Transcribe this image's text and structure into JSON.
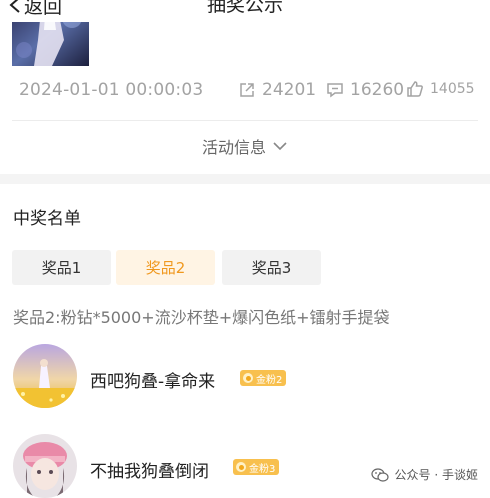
{
  "header": {
    "back_label": "返回",
    "title": "抽奖公示"
  },
  "post": {
    "date": "2024-01-01 00:00:03",
    "shares": "24201",
    "comments": "16260",
    "likes": "14055"
  },
  "activity_toggle": "活动信息",
  "winners": {
    "title": "中奖名单",
    "tabs": [
      {
        "label": "奖品1",
        "active": false
      },
      {
        "label": "奖品2",
        "active": true
      },
      {
        "label": "奖品3",
        "active": false
      }
    ],
    "prize_description": "奖品2:粉钻*5000+流沙杯垫+爆闪色纸+镭射手提袋",
    "list": [
      {
        "name": "西吧狗叠-拿命来",
        "badge": "金粉2"
      },
      {
        "name": "不抽我狗叠倒闭",
        "badge": "金粉3"
      }
    ]
  },
  "watermark": "公众号 · 手谈姬",
  "colors": {
    "accent": "#f0981e",
    "badge": "#f8c04e",
    "muted": "#a3a3a3"
  }
}
